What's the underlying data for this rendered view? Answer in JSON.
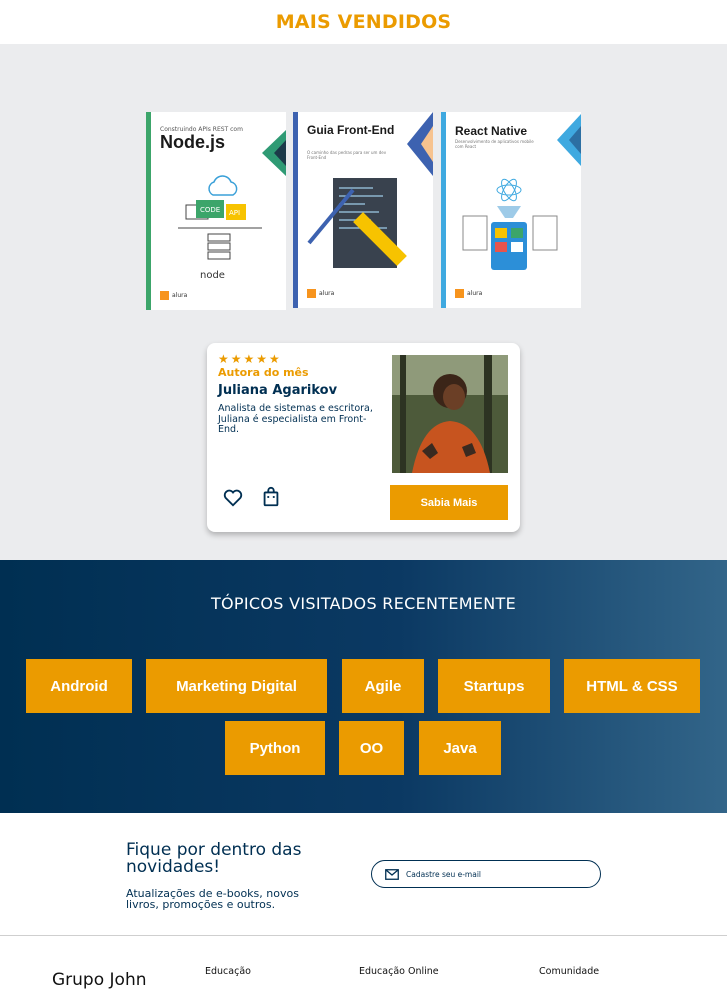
{
  "header": {
    "title": "MAIS VENDIDOS"
  },
  "carousel": {
    "dots_total": 4,
    "active_dot": 1,
    "books": [
      {
        "title": "Node.js",
        "subtitle": "Construindo APIs REST com",
        "brand": "alura"
      },
      {
        "title": "Guia Front-End",
        "subtitle": "O caminho das pedras para ser um dev Front-End",
        "brand": "alura"
      },
      {
        "title": "React Native",
        "subtitle": "Desenvolvimento de aplicativos mobile com React",
        "brand": "alura"
      }
    ]
  },
  "author_card": {
    "rating": 5,
    "label": "Autora do mês",
    "name": "Juliana Agarikov",
    "description": "Analista de sistemas e escritora, Juliana é especialista em Front-End.",
    "button": "Sabia Mais"
  },
  "topics": {
    "title": "TÓPICOS VISITADOS RECENTEMENTE",
    "items": [
      "Android",
      "Marketing Digital",
      "Agile",
      "Startups",
      "HTML & CSS",
      "Python",
      "OO",
      "Java"
    ]
  },
  "newsletter": {
    "title": "Fique por dentro das novidades!",
    "text": "Atualizações de e-books, novos livros, promoções e outros.",
    "placeholder": "Cadastre seu e-mail"
  },
  "footer": {
    "logo": "Grupo John",
    "columns": [
      "Educação",
      "Educação Online",
      "Comunidade"
    ]
  },
  "colors": {
    "accent": "#EB9B00",
    "navy": "#002F52",
    "dot_active": "#1875E8"
  }
}
